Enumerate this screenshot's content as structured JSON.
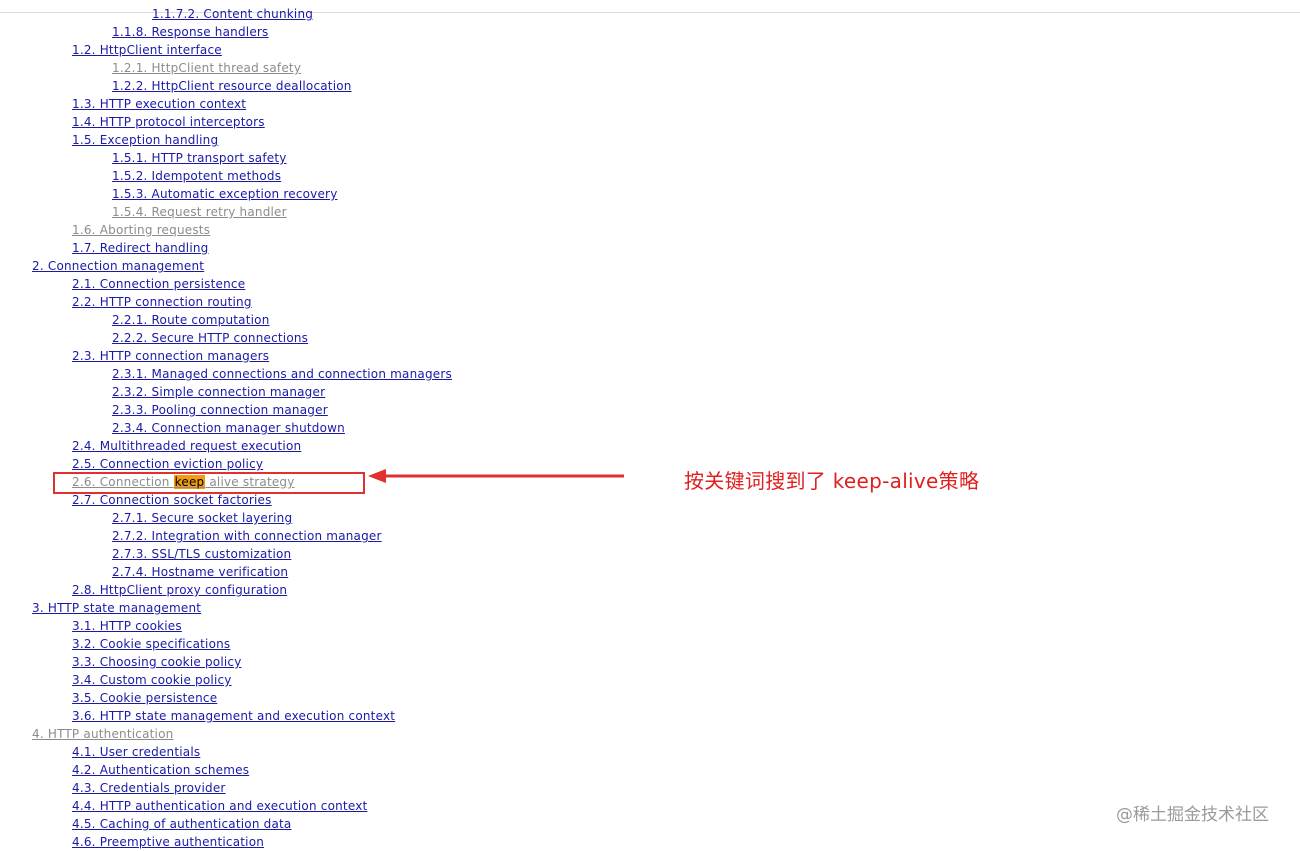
{
  "toc": [
    {
      "level": 4,
      "text": "1.1.7.2. Content chunking",
      "visited": false
    },
    {
      "level": 3,
      "text": "1.1.8. Response handlers",
      "visited": false
    },
    {
      "level": 2,
      "text": "1.2. HttpClient interface",
      "visited": false
    },
    {
      "level": 3,
      "text": "1.2.1. HttpClient thread safety",
      "visited": true
    },
    {
      "level": 3,
      "text": "1.2.2. HttpClient resource deallocation",
      "visited": false
    },
    {
      "level": 2,
      "text": "1.3. HTTP execution context",
      "visited": false
    },
    {
      "level": 2,
      "text": "1.4. HTTP protocol interceptors",
      "visited": false
    },
    {
      "level": 2,
      "text": "1.5. Exception handling",
      "visited": false
    },
    {
      "level": 3,
      "text": "1.5.1. HTTP transport safety",
      "visited": false
    },
    {
      "level": 3,
      "text": "1.5.2. Idempotent methods",
      "visited": false
    },
    {
      "level": 3,
      "text": "1.5.3. Automatic exception recovery",
      "visited": false
    },
    {
      "level": 3,
      "text": "1.5.4. Request retry handler",
      "visited": true
    },
    {
      "level": 2,
      "text": "1.6. Aborting requests",
      "visited": true
    },
    {
      "level": 2,
      "text": "1.7. Redirect handling",
      "visited": false
    },
    {
      "level": 1,
      "text": "2. Connection management",
      "visited": false
    },
    {
      "level": 2,
      "text": "2.1. Connection persistence",
      "visited": false
    },
    {
      "level": 2,
      "text": "2.2. HTTP connection routing",
      "visited": false
    },
    {
      "level": 3,
      "text": "2.2.1. Route computation",
      "visited": false
    },
    {
      "level": 3,
      "text": "2.2.2. Secure HTTP connections",
      "visited": false
    },
    {
      "level": 2,
      "text": "2.3. HTTP connection managers",
      "visited": false
    },
    {
      "level": 3,
      "text": "2.3.1. Managed connections and connection managers",
      "visited": false
    },
    {
      "level": 3,
      "text": "2.3.2. Simple connection manager",
      "visited": false
    },
    {
      "level": 3,
      "text": "2.3.3. Pooling connection manager",
      "visited": false
    },
    {
      "level": 3,
      "text": "2.3.4. Connection manager shutdown",
      "visited": false
    },
    {
      "level": 2,
      "text": "2.4. Multithreaded request execution",
      "visited": false
    },
    {
      "level": 2,
      "text": "2.5. Connection eviction policy",
      "visited": false
    },
    {
      "level": 2,
      "text_before": "2.6. Connection ",
      "highlight": "keep",
      "text_after": " alive strategy",
      "visited": true
    },
    {
      "level": 2,
      "text": "2.7. Connection socket factories",
      "visited": false
    },
    {
      "level": 3,
      "text": "2.7.1. Secure socket layering",
      "visited": false
    },
    {
      "level": 3,
      "text": "2.7.2. Integration with connection manager",
      "visited": false
    },
    {
      "level": 3,
      "text": "2.7.3. SSL/TLS customization",
      "visited": false
    },
    {
      "level": 3,
      "text": "2.7.4. Hostname verification",
      "visited": false
    },
    {
      "level": 2,
      "text": "2.8. HttpClient proxy configuration",
      "visited": false
    },
    {
      "level": 1,
      "text": "3. HTTP state management",
      "visited": false
    },
    {
      "level": 2,
      "text": "3.1. HTTP cookies",
      "visited": false
    },
    {
      "level": 2,
      "text": "3.2. Cookie specifications",
      "visited": false
    },
    {
      "level": 2,
      "text": "3.3. Choosing cookie policy",
      "visited": false
    },
    {
      "level": 2,
      "text": "3.4. Custom cookie policy",
      "visited": false
    },
    {
      "level": 2,
      "text": "3.5. Cookie persistence",
      "visited": false
    },
    {
      "level": 2,
      "text": "3.6. HTTP state management and execution context",
      "visited": false
    },
    {
      "level": 1,
      "text": "4. HTTP authentication",
      "visited": true
    },
    {
      "level": 2,
      "text": "4.1. User credentials",
      "visited": false
    },
    {
      "level": 2,
      "text": "4.2. Authentication schemes",
      "visited": false
    },
    {
      "level": 2,
      "text": "4.3. Credentials provider",
      "visited": false
    },
    {
      "level": 2,
      "text": "4.4. HTTP authentication and execution context",
      "visited": false
    },
    {
      "level": 2,
      "text": "4.5. Caching of authentication data",
      "visited": false
    },
    {
      "level": 2,
      "text": "4.6. Preemptive authentication",
      "visited": false
    }
  ],
  "annotation": {
    "note": "按关键词搜到了 keep-alive策略",
    "color": "#e03030"
  },
  "watermark": "@稀土掘金技术社区",
  "colors": {
    "link": "#1a1aa6",
    "visited": "#8c8c8c",
    "search_highlight": "#f39c12"
  }
}
